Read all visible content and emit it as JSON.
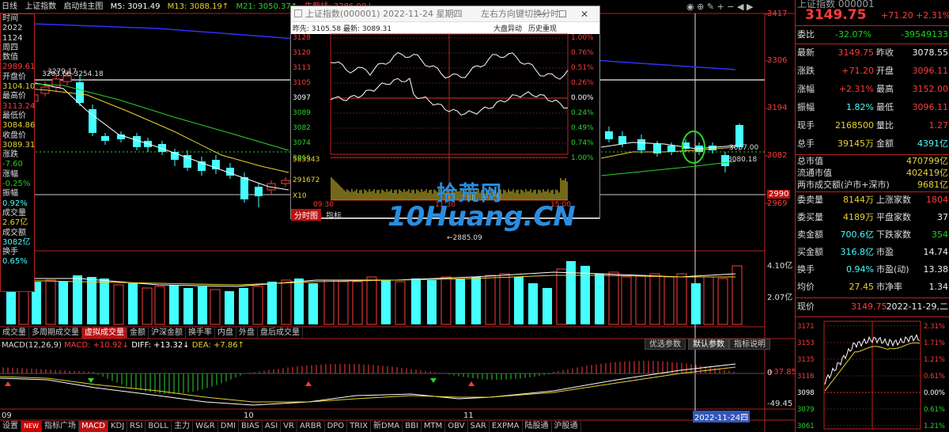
{
  "header": {
    "period": "日线",
    "name": "上证指数",
    "view": "启动线主图",
    "ma5": "M5: 3091.49",
    "ma13": "M13: 3088.19↑",
    "ma21": "M21: 3050.37↑",
    "niu": "牛熊线: 3286.90↓"
  },
  "info_panel": [
    {
      "t": "时间",
      "c": "#ddd"
    },
    {
      "t": "2022",
      "c": "#ddd"
    },
    {
      "t": "1124",
      "c": "#ddd"
    },
    {
      "t": "周四",
      "c": "#ddd"
    },
    {
      "t": "数值",
      "c": "#ddd"
    },
    {
      "t": "2989.61",
      "c": "#ff3b3b"
    },
    {
      "t": "开盘价",
      "c": "#ddd"
    },
    {
      "t": "3104.10",
      "c": "#e8d230"
    },
    {
      "t": "最高价",
      "c": "#ddd"
    },
    {
      "t": "3113.24",
      "c": "#ff3b3b"
    },
    {
      "t": "最低价",
      "c": "#ddd"
    },
    {
      "t": "3084.86",
      "c": "#e8d230"
    },
    {
      "t": "收盘价",
      "c": "#ddd"
    },
    {
      "t": "3089.31",
      "c": "#e8d230"
    },
    {
      "t": "涨跌",
      "c": "#ddd"
    },
    {
      "t": "-7.60",
      "c": "#19d419"
    },
    {
      "t": "涨幅",
      "c": "#ddd"
    },
    {
      "t": "-0.25%",
      "c": "#19d419"
    },
    {
      "t": "振幅",
      "c": "#ddd"
    },
    {
      "t": "0.92%",
      "c": "#4ff"
    },
    {
      "t": "成交量",
      "c": "#ddd"
    },
    {
      "t": "2.67亿",
      "c": "#e8d230"
    },
    {
      "t": "成交额",
      "c": "#ddd"
    },
    {
      "t": "3082亿",
      "c": "#4ff"
    },
    {
      "t": "换手",
      "c": "#ddd"
    },
    {
      "t": "0.65%",
      "c": "#4ff"
    }
  ],
  "main_chart": {
    "y_labels": [
      "3417",
      "3306",
      "3194",
      "3082",
      "2990",
      "2969"
    ],
    "annotations": {
      "a1": "3279.17",
      "a2": "3203.66-3254.18",
      "low": "←2885.09",
      "cur1": "3087.00",
      "cur2": "3080.18"
    }
  },
  "popup": {
    "title": "上证指数(000001) 2022-11-24 星期四",
    "hint": "左右方向键切换分时",
    "close": "✕",
    "min": "−",
    "max": "☐",
    "zuoshou_label": "昨先:",
    "zuoshou": "3105.58",
    "latest_label": "最新:",
    "latest": "3089.31",
    "btn1": "大盘异动",
    "btn2": "历史重现",
    "left_y": [
      "3128",
      "3120",
      "3113",
      "3105",
      "3097",
      "3089",
      "3082",
      "3074",
      "3066"
    ],
    "right_y": [
      "1.00%",
      "0.76%",
      "0.51%",
      "0.26%",
      "0.00%",
      "0.24%",
      "0.49%",
      "0.74%",
      "1.00%"
    ],
    "vol_y": [
      "583343",
      "291672",
      "X10"
    ],
    "x_labels": [
      "09:30",
      "11:30",
      "15:00"
    ],
    "tab1": "分时图",
    "tab2": "指标"
  },
  "watermark": {
    "line1": "拾荒网",
    "line2": "10Huang.CN"
  },
  "volume_chart": {
    "y_labels": [
      "4.10亿",
      "2.07亿"
    ]
  },
  "vol_tabs": [
    "成交量",
    "多周期成交量",
    "虚拟成交量",
    "金额",
    "沪深金额",
    "换手率",
    "内盘",
    "外盘",
    "盘后成交量"
  ],
  "vol_tab_active": 2,
  "macd": {
    "title": "MACD(12,26,9)",
    "macd": "MACD: +10.92↓",
    "diff": "DIFF: +13.32↓",
    "dea": "DEA: +7.86↑",
    "y_labels": [
      "+37.85",
      "0",
      "-49.45"
    ],
    "btn1": "优选参数",
    "btn2": "默认参数",
    "btn3": "指标说明"
  },
  "date_axis": {
    "labels": [
      "09",
      "10",
      "11"
    ],
    "current": "2022-11-24四"
  },
  "indicator_tabs": [
    "设置",
    "NEW",
    "指标广场",
    "MACD",
    "KDJ",
    "RSI",
    "BOLL",
    "主力",
    "W&R",
    "DMI",
    "BIAS",
    "ASI",
    "VR",
    "ARBR",
    "DPO",
    "TRIX",
    "新DMA",
    "BBI",
    "MTM",
    "OBV",
    "SAR",
    "EXPMA",
    "陆股通",
    "沪股通"
  ],
  "indicator_active": 3,
  "right_panel": {
    "title": "上证指数 000001",
    "price": "3149.75",
    "change": "+71.20",
    "pct": "+2.31%",
    "weibi_k": "委比",
    "weibi_v": "-32.07%",
    "weicha_v": "-39549133",
    "rows1": [
      {
        "k": "最新",
        "v": "3149.75",
        "vc": "red",
        "k2": "昨收",
        "v2": "3078.55",
        "v2c": "wht"
      },
      {
        "k": "涨跌",
        "v": "+71.20",
        "vc": "red",
        "k2": "开盘",
        "v2": "3096.11",
        "v2c": "red"
      },
      {
        "k": "涨幅",
        "v": "+2.31%",
        "vc": "red",
        "k2": "最高",
        "v2": "3152.00",
        "v2c": "red"
      },
      {
        "k": "振幅",
        "v": "1.82%",
        "vc": "cyan",
        "k2": "最低",
        "v2": "3096.11",
        "v2c": "red"
      },
      {
        "k": "现手",
        "v": "2168500",
        "vc": "yel",
        "k2": "量比",
        "v2": "1.27",
        "v2c": "red"
      },
      {
        "k": "总手",
        "v": "39145万",
        "vc": "yel",
        "k2": "金额",
        "v2": "4391亿",
        "v2c": "cyan"
      }
    ],
    "rows2": [
      {
        "k": "总市值",
        "v": "470799亿",
        "vc": "yel"
      },
      {
        "k": "流通市值",
        "v": "402419亿",
        "vc": "yel"
      },
      {
        "k": "两市成交额(沪市+深市)",
        "v": "9681亿",
        "vc": "yel"
      }
    ],
    "rows3": [
      {
        "k": "委卖量",
        "v": "8144万",
        "vc": "yel",
        "k2": "上涨家数",
        "v2": "1804",
        "v2c": "red"
      },
      {
        "k": "委买量",
        "v": "4189万",
        "vc": "yel",
        "k2": "平盘家数",
        "v2": "37",
        "v2c": "wht"
      },
      {
        "k": "卖金额",
        "v": "700.6亿",
        "vc": "cyan",
        "k2": "下跌家数",
        "v2": "354",
        "v2c": "green"
      },
      {
        "k": "买金额",
        "v": "316.8亿",
        "vc": "cyan",
        "k2": "市盈",
        "v2": "14.74",
        "v2c": "wht"
      },
      {
        "k": "换手",
        "v": "0.94%",
        "vc": "cyan",
        "k2": "市盈(动)",
        "v2": "13.38",
        "v2c": "wht"
      },
      {
        "k": "均价",
        "v": "27.45",
        "vc": "yel",
        "k2": "市净率",
        "v2": "1.34",
        "v2c": "wht"
      }
    ],
    "xianjia_k": "现价",
    "xianjia_v": "3149.75",
    "date": "2022-11-29,二",
    "mini_left": [
      "3171",
      "3153",
      "3135",
      "3116",
      "3098",
      "3079",
      "3061"
    ],
    "mini_right": [
      "2.31%",
      "1.71%",
      "1.21%",
      "0.61%",
      "0.00%",
      "0.61%",
      "1.21%"
    ]
  },
  "colors": {
    "up": "#ff3b3b",
    "down": "#4ff",
    "grid": "#b22222",
    "ma5": "#ffffff",
    "ma13": "#e8d230",
    "ma21": "#2bd42b",
    "niu": "#3030ff"
  }
}
